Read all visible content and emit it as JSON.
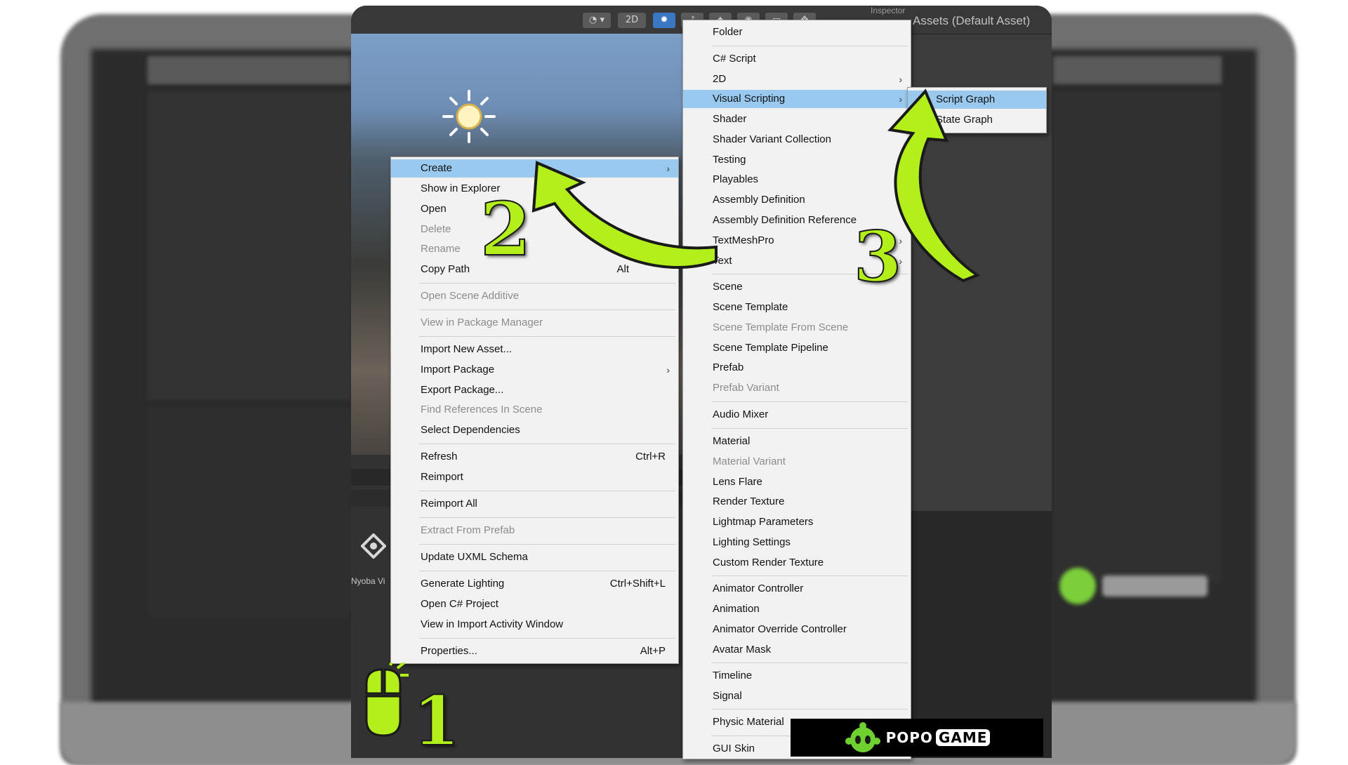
{
  "toolbar": {
    "btn_2d": "2D"
  },
  "inspector": {
    "tab_label": "Inspector",
    "title": "Assets (Default Asset)"
  },
  "scene": {
    "bottom_label": "Nyoba Vi"
  },
  "context_menu": {
    "items": [
      {
        "label": "Create",
        "arrow": "›"
      },
      {
        "label": "Show in Explorer"
      },
      {
        "label": "Open"
      },
      {
        "label": "Delete"
      },
      {
        "label": "Rename"
      },
      {
        "label": "Copy Path",
        "shortcut": "Alt"
      },
      {
        "label": "Open Scene Additive"
      },
      {
        "label": "View in Package Manager"
      },
      {
        "label": "Import New Asset..."
      },
      {
        "label": "Import Package",
        "arrow": "›"
      },
      {
        "label": "Export Package..."
      },
      {
        "label": "Find References In Scene"
      },
      {
        "label": "Select Dependencies"
      },
      {
        "label": "Refresh",
        "shortcut": "Ctrl+R"
      },
      {
        "label": "Reimport"
      },
      {
        "label": "Reimport All"
      },
      {
        "label": "Extract From Prefab"
      },
      {
        "label": "Update UXML Schema"
      },
      {
        "label": "Generate Lighting",
        "shortcut": "Ctrl+Shift+L"
      },
      {
        "label": "Open C# Project"
      },
      {
        "label": "View in Import Activity Window"
      },
      {
        "label": "Properties...",
        "shortcut": "Alt+P"
      }
    ]
  },
  "create_menu": {
    "items": [
      {
        "label": "Folder"
      },
      {
        "label": "C# Script"
      },
      {
        "label": "2D",
        "arrow": "›"
      },
      {
        "label": "Visual Scripting",
        "arrow": "›"
      },
      {
        "label": "Shader"
      },
      {
        "label": "Shader Variant Collection"
      },
      {
        "label": "Testing"
      },
      {
        "label": "Playables"
      },
      {
        "label": "Assembly Definition"
      },
      {
        "label": "Assembly Definition Reference"
      },
      {
        "label": "TextMeshPro",
        "arrow": "›"
      },
      {
        "label": "Text",
        "arrow": "›"
      },
      {
        "label": "Scene"
      },
      {
        "label": "Scene Template"
      },
      {
        "label": "Scene Template From Scene"
      },
      {
        "label": "Scene Template Pipeline"
      },
      {
        "label": "Prefab"
      },
      {
        "label": "Prefab Variant"
      },
      {
        "label": "Audio Mixer"
      },
      {
        "label": "Material"
      },
      {
        "label": "Material Variant"
      },
      {
        "label": "Lens Flare"
      },
      {
        "label": "Render Texture"
      },
      {
        "label": "Lightmap Parameters"
      },
      {
        "label": "Lighting Settings"
      },
      {
        "label": "Custom Render Texture"
      },
      {
        "label": "Animator Controller"
      },
      {
        "label": "Animation"
      },
      {
        "label": "Animator Override Controller"
      },
      {
        "label": "Avatar Mask"
      },
      {
        "label": "Timeline"
      },
      {
        "label": "Signal"
      },
      {
        "label": "Physic Material"
      },
      {
        "label": "GUI Skin"
      }
    ]
  },
  "visual_scripting_menu": {
    "items": [
      {
        "label": "Script Graph"
      },
      {
        "label": "State Graph"
      }
    ]
  },
  "annotations": {
    "step1": "1",
    "step2": "2",
    "step3": "3"
  },
  "branding": {
    "logo_left": "POPO",
    "logo_right": "GAME"
  },
  "colors": {
    "highlight": "#99c9ef",
    "annotation_green": "#b3ef1b",
    "menu_bg": "#f2f2f2"
  }
}
